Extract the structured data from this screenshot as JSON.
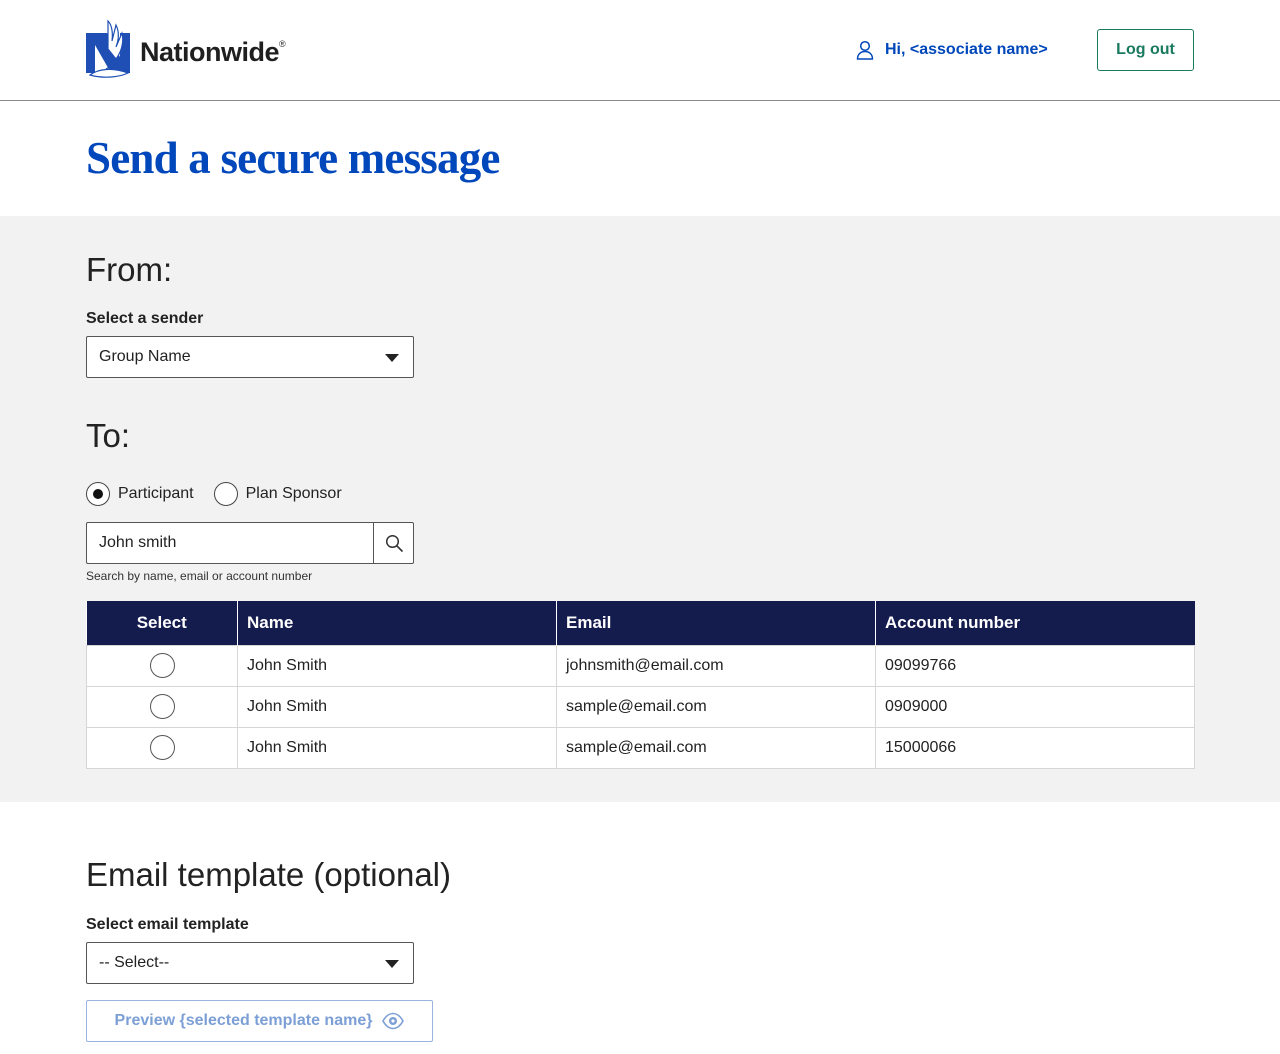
{
  "header": {
    "brand": "Nationwide",
    "brand_mark": "®",
    "greeting": "Hi, <associate name>",
    "logout_label": "Log out"
  },
  "page": {
    "title": "Send a secure message"
  },
  "from": {
    "heading": "From:",
    "sender_label": "Select a sender",
    "sender_value": "Group Name"
  },
  "to": {
    "heading": "To:",
    "recipient_types": [
      {
        "label": "Participant",
        "checked": true
      },
      {
        "label": "Plan Sponsor",
        "checked": false
      }
    ],
    "search_value": "John smith",
    "search_helper": "Search by name, email or account number"
  },
  "results": {
    "columns": [
      "Select",
      "Name",
      "Email",
      "Account number"
    ],
    "rows": [
      {
        "name": "John Smith",
        "email": "johnsmith@email.com",
        "account": "09099766"
      },
      {
        "name": "John Smith",
        "email": "sample@email.com",
        "account": "0909000"
      },
      {
        "name": "John Smith",
        "email": "sample@email.com",
        "account": "15000066"
      }
    ]
  },
  "template": {
    "heading": "Email template (optional)",
    "select_label": "Select email template",
    "select_value": "-- Select--",
    "preview_label": "Preview {selected template name}"
  },
  "colors": {
    "brand_blue": "#0047bb",
    "navy": "#141b4d",
    "green": "#1a7a5e",
    "section_gray": "#f2f2f2",
    "disabled_blue": "#7c9fd6"
  },
  "icons": {
    "logo": "nationwide-eagle-logo-icon",
    "user": "user-icon",
    "search": "search-icon",
    "dropdown": "caret-down-icon",
    "preview": "eye-icon"
  }
}
